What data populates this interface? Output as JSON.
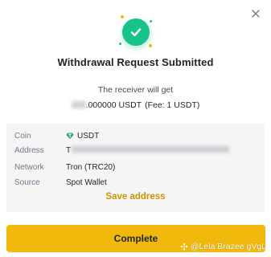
{
  "dialog": {
    "title": "Withdrawal Request Submitted",
    "receiver_label": "The receiver will get",
    "amount_value": ".000000 USDT",
    "fee_text": "(Fee: 1 USDT)",
    "close_icon": "close-icon",
    "success_icon": "check-circle-icon",
    "accent_color": "#16c38a"
  },
  "details": [
    {
      "label": "Coin",
      "value": "USDT",
      "icon": "usdt-icon"
    },
    {
      "label": "Address",
      "value": "T"
    },
    {
      "label": "Network",
      "value": "Tron (TRC20)"
    },
    {
      "label": "Source",
      "value": "Spot Wallet"
    }
  ],
  "save_address_label": "Save address",
  "complete_label": "Complete",
  "brand_color": "#f0b90b",
  "watermark": "@Lela Brazee gVgL"
}
